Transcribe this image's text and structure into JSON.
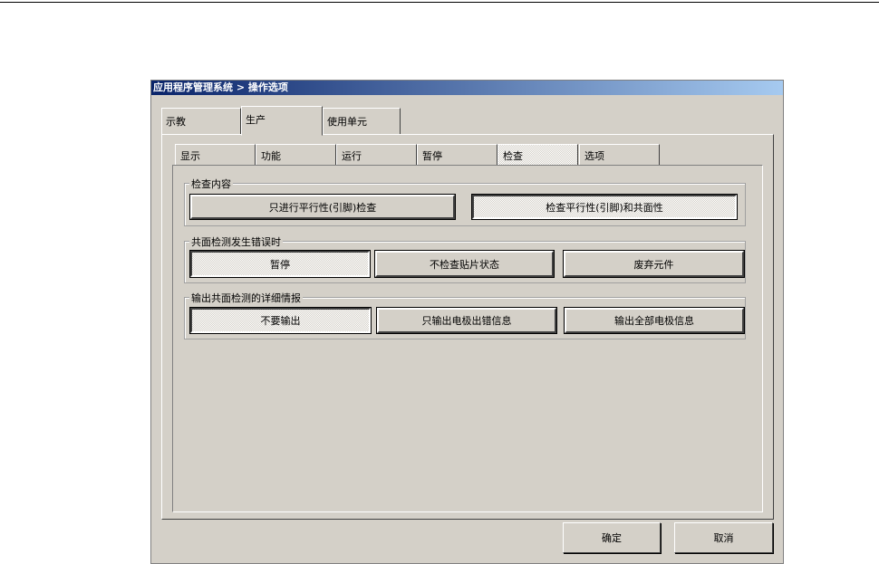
{
  "title": "应用程序管理系统 > 操作选项",
  "outer_tabs": [
    "示教",
    "生产",
    "使用单元"
  ],
  "inner_tabs": [
    "显示",
    "功能",
    "运行",
    "暂停",
    "检查",
    "选项"
  ],
  "groups": [
    {
      "label": "检查内容",
      "buttons": [
        "只进行平行性(引脚)检查",
        "检查平行性(引脚)和共面性"
      ],
      "selected": 1
    },
    {
      "label": "共面检测发生错误时",
      "buttons": [
        "暂停",
        "不检查贴片状态",
        "废弃元件"
      ],
      "selected": 0
    },
    {
      "label": "输出共面检测的详细情报",
      "buttons": [
        "不要输出",
        "只输出电极出错信息",
        "输出全部电极信息"
      ],
      "selected": 0
    }
  ],
  "footer": {
    "ok": "确定",
    "cancel": "取消"
  }
}
